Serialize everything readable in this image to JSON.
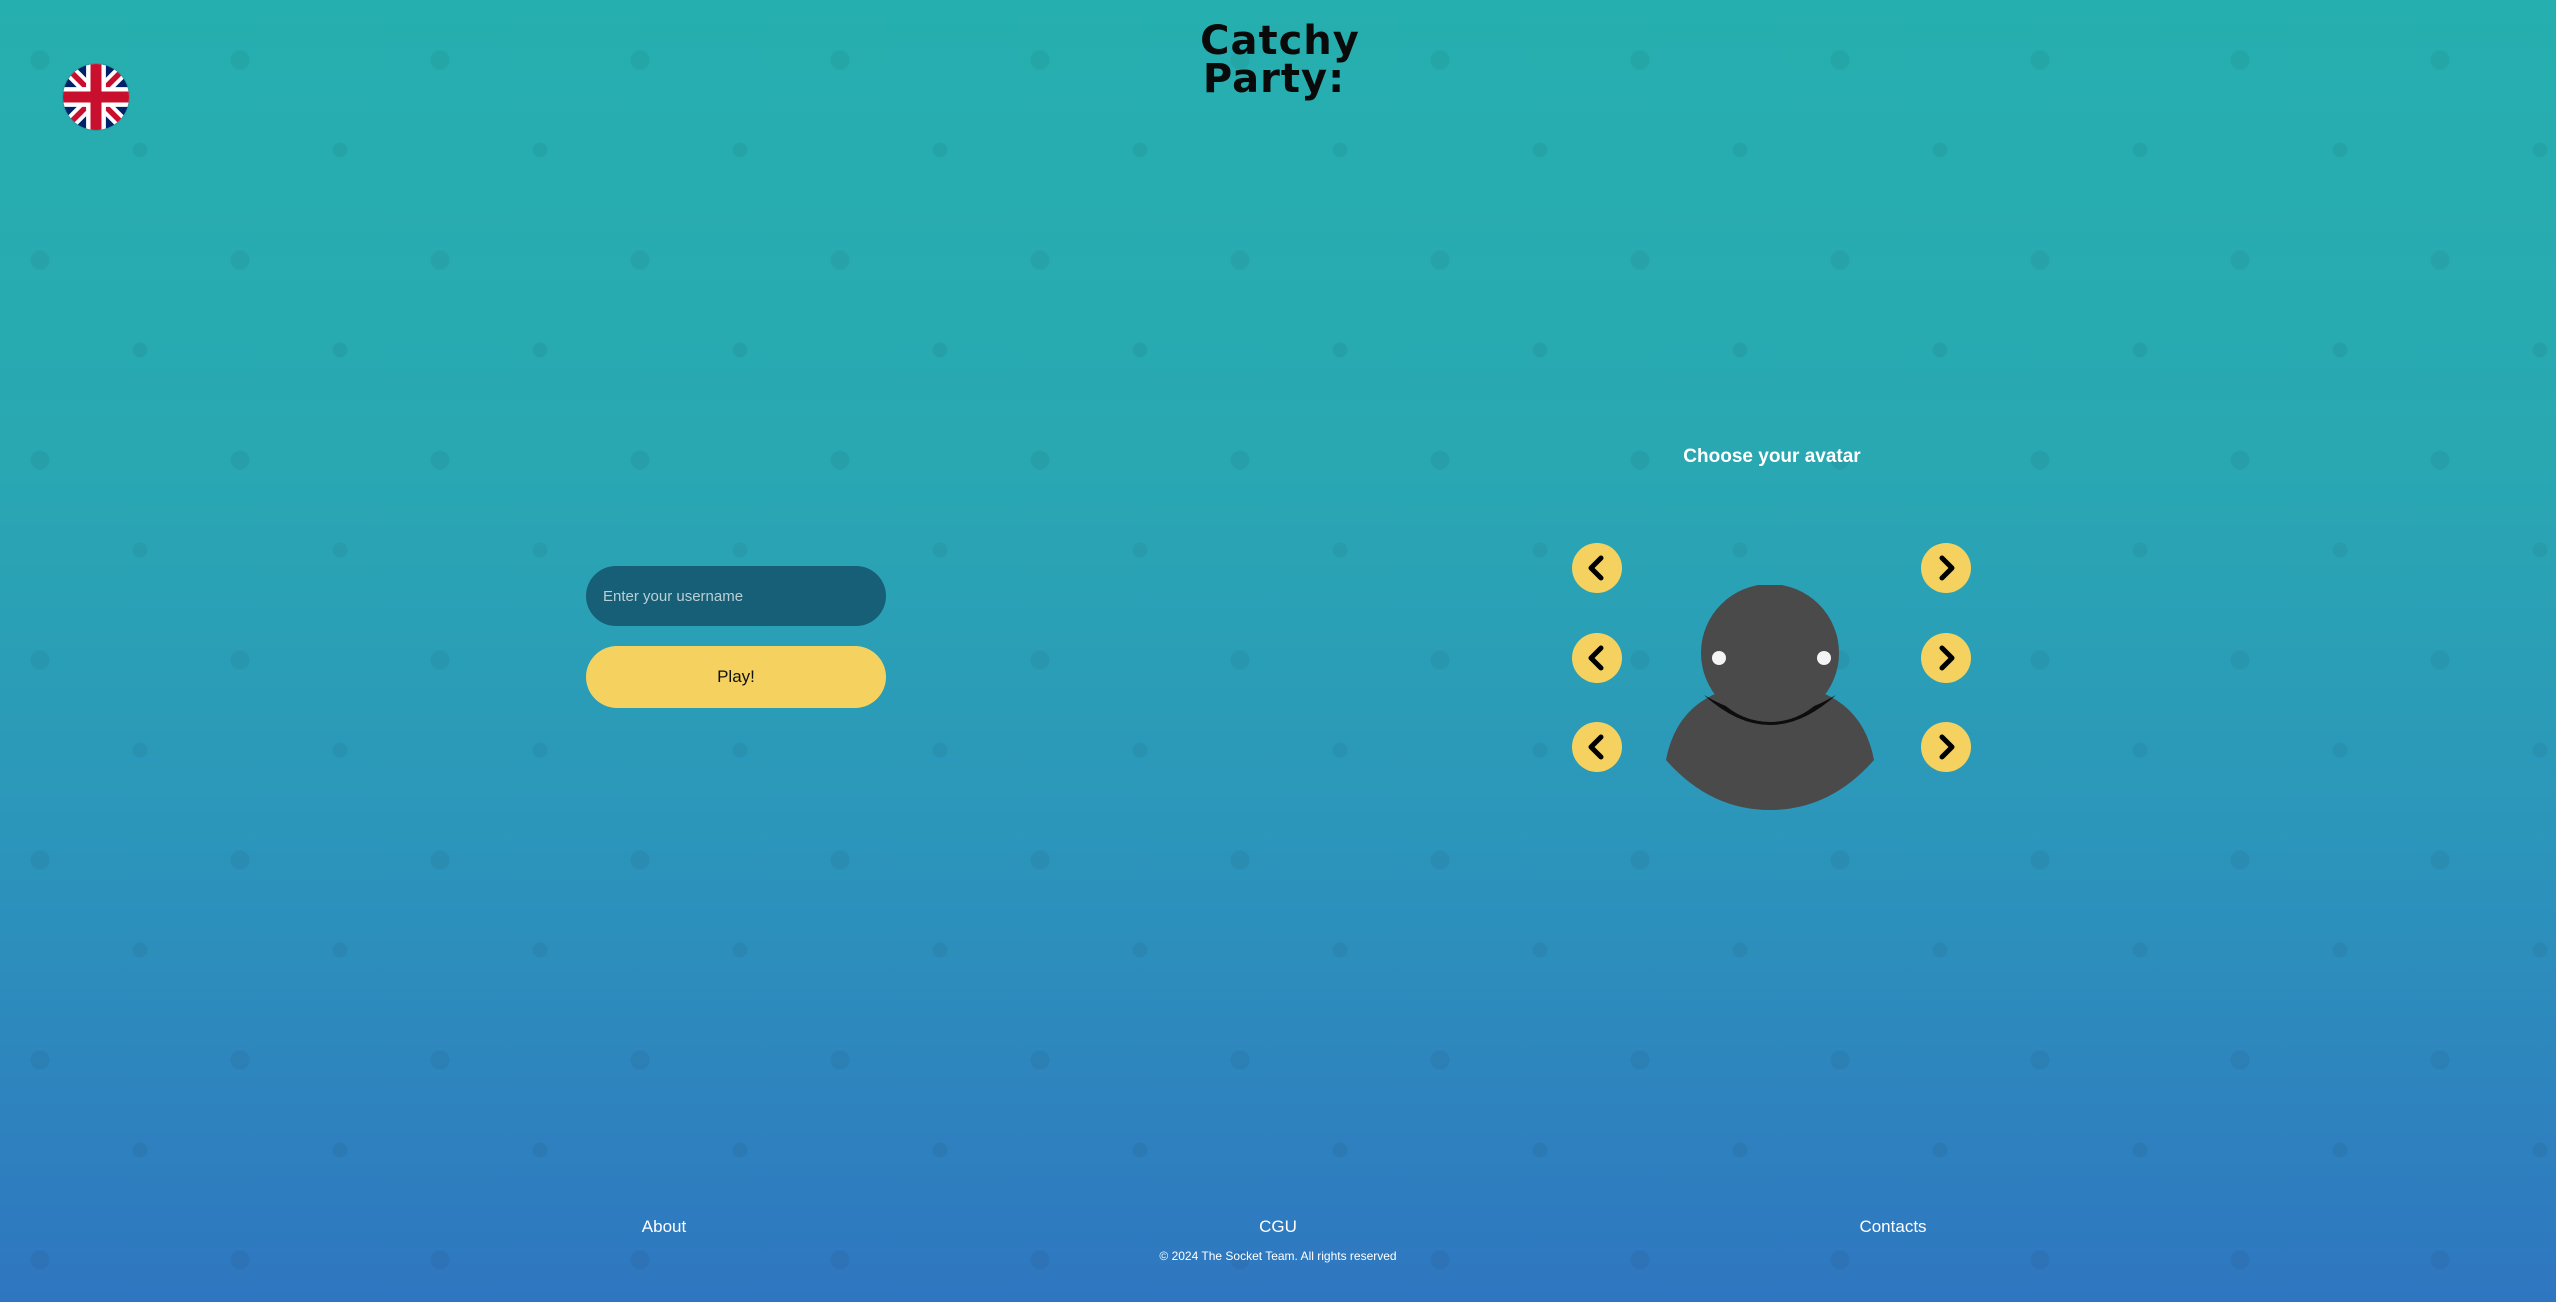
{
  "logo": {
    "line1": "Catchy",
    "line2": "Party:"
  },
  "language": {
    "icon": "uk-flag-icon"
  },
  "form": {
    "username_placeholder": "Enter your username",
    "play_label": "Play!"
  },
  "avatar_picker": {
    "title": "Choose your avatar",
    "left_icon": "chevron-left-icon",
    "right_icon": "chevron-right-icon",
    "avatar_icon": "avatar-icon"
  },
  "footer": {
    "about": "About",
    "cgu": "CGU",
    "contacts": "Contacts",
    "copyright": "© 2024 The Socket Team. All rights reserved"
  },
  "colors": {
    "accent": "#f5d25f",
    "input_bg": "#175f77",
    "avatar": "#4a4a4a"
  }
}
